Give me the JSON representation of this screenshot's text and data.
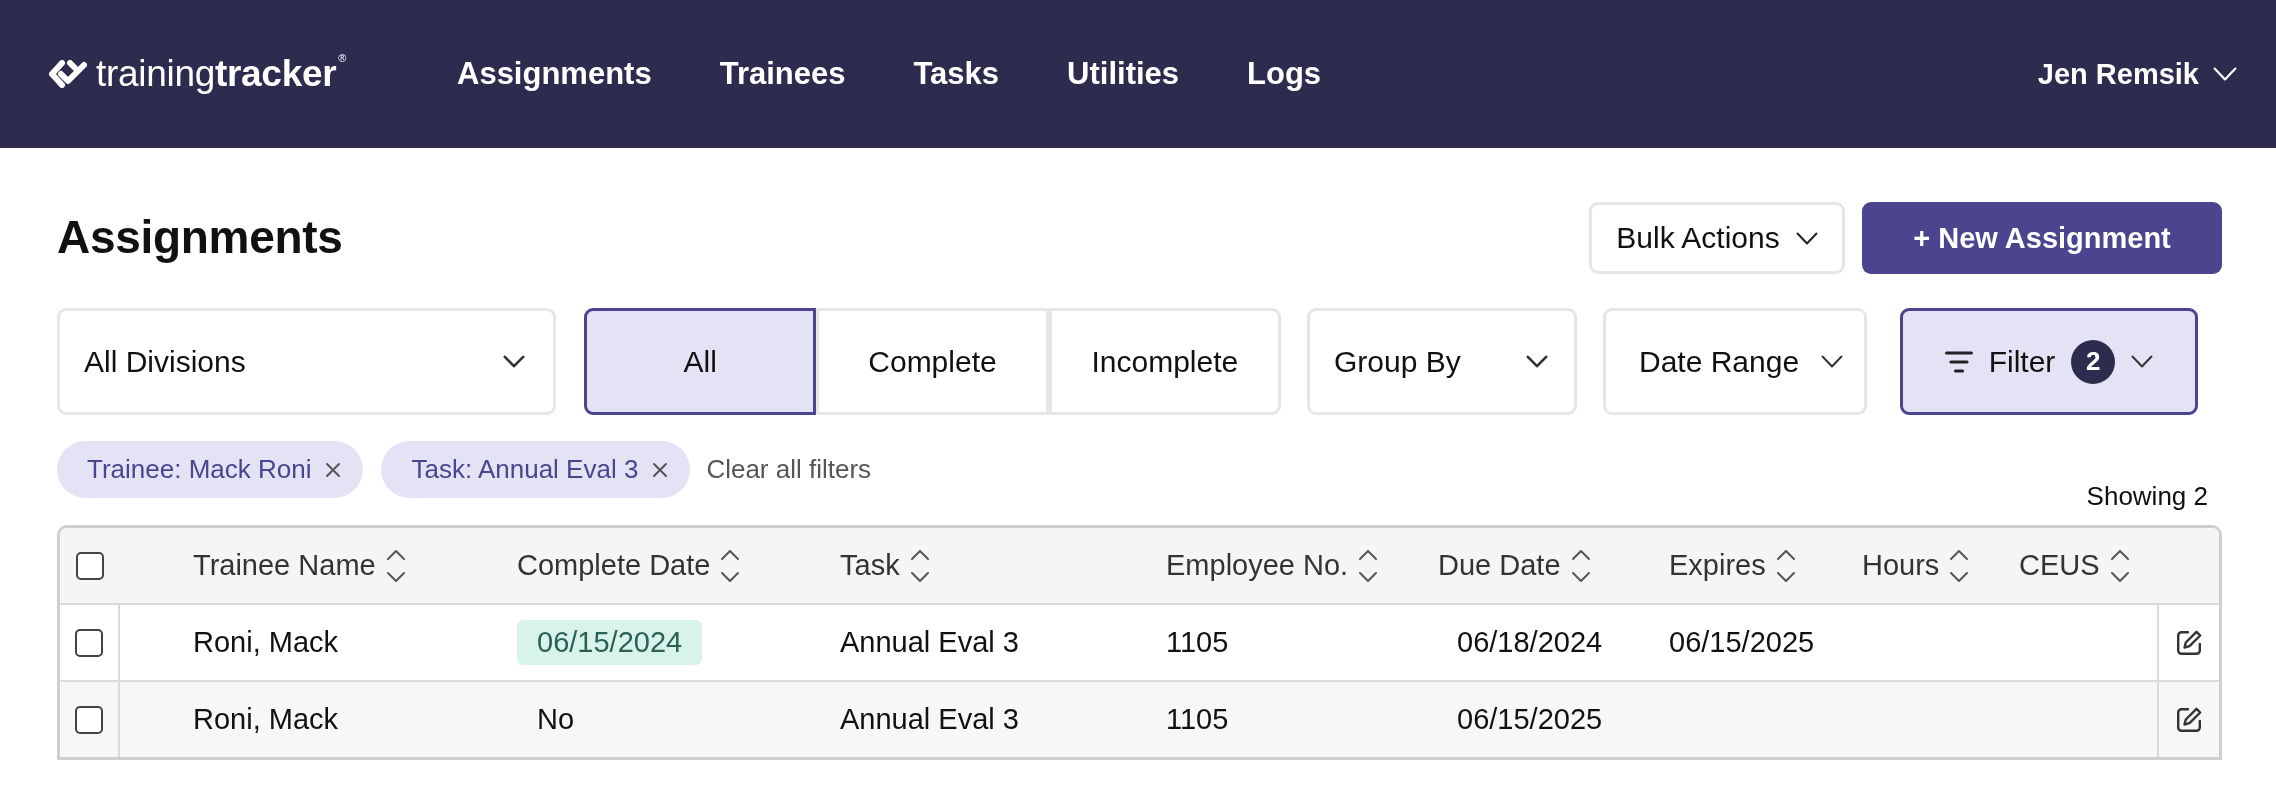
{
  "header": {
    "logo": "training**tracker**$^{®}$",
    "nav": [
      "Assignments",
      "Trainees",
      "Tasks",
      "Utilities",
      "Logs"
    ],
    "user": "Jen Remsik"
  },
  "page": {
    "title": "Assignments",
    "actions": [
      {
        "label": "Bulk Actions",
        "kind": "menu"
      },
      {
        "label": "+ New Assignment",
        "kind": "primary"
      }
    ]
  },
  "filters": {
    "division": "All Divisions",
    "status_tabs": [
      {
        "label": "All",
        "selected": true
      },
      {
        "label": "Complete",
        "selected": false
      },
      {
        "label": "Incomplete",
        "selected": false
      }
    ],
    "group_by": "Group By",
    "date_range": "Date Range",
    "filter": {
      "label": "Filter",
      "count": "2",
      "active": true
    }
  },
  "applied_filters": {
    "chips": [
      "Trainee: Mack Roni",
      "Task: Annual Eval 3"
    ],
    "clear": "Clear all filters"
  },
  "result_count": "Showing 2",
  "table": {
    "select_all": {
      "checked": false
    },
    "columns": [
      "Trainee Name",
      "Complete Date",
      "Task",
      "Employee No.",
      "Due Date",
      "Expires",
      "Hours",
      "CEUS"
    ],
    "rows": [
      {
        "checked": false,
        "completed": true,
        "cells": [
          "Roni, Mack",
          "06/15/2024",
          "Annual Eval 3",
          "1105",
          "06/18/2024",
          "06/15/2025"
        ]
      },
      {
        "checked": false,
        "completed": false,
        "cells": [
          "Roni, Mack",
          "No",
          "Annual Eval 3",
          "1105",
          "06/15/2025"
        ]
      }
    ]
  }
}
